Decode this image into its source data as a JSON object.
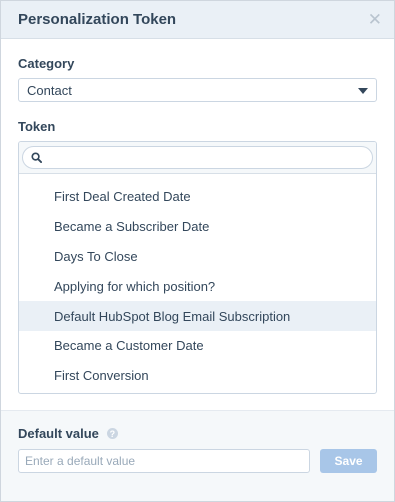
{
  "dialog": {
    "title": "Personalization Token",
    "close_icon": "close-icon"
  },
  "category": {
    "label": "Category",
    "selected": "Contact"
  },
  "token": {
    "label": "Token",
    "search_placeholder": "",
    "items": [
      "First Deal Created Date",
      "Became a Subscriber Date",
      "Days To Close",
      "Applying for which position?",
      "Default HubSpot Blog Email Subscription",
      "Became a Customer Date",
      "First Conversion"
    ]
  },
  "default_value": {
    "label": "Default value",
    "placeholder": "Enter a default value",
    "help_icon": "help-icon"
  },
  "save": {
    "label": "Save"
  },
  "colors": {
    "header_bg": "#eaf0f6",
    "footer_bg": "#f5f8fa",
    "save_button": "#a8c6e8",
    "hover_row": "#eaf0f6",
    "text": "#33475b"
  }
}
